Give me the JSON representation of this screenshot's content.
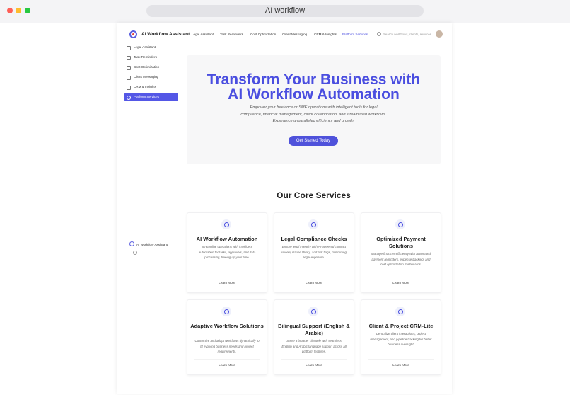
{
  "window": {
    "title": "AI workflow"
  },
  "nav": {
    "brand": "AI Workflow Assistant",
    "links": [
      "Legal Assistant",
      "Task Reminders",
      "Cost Optimization",
      "Client Messaging",
      "CRM & Insights",
      "Platform Services"
    ],
    "search_placeholder": "Search workflows, clients, services..."
  },
  "sidebar": {
    "items": [
      {
        "label": "Legal Assistant"
      },
      {
        "label": "Task Reminders"
      },
      {
        "label": "Cost Optimization"
      },
      {
        "label": "Client Messaging"
      },
      {
        "label": "CRM & Insights"
      },
      {
        "label": "Platform Services",
        "active": true
      }
    ],
    "footer_label": "AI Workflow Assistant"
  },
  "hero": {
    "title_line1": "Transform Your Business with",
    "title_line2": "AI Workflow Automation",
    "subtitle": "Empower your freelance or SME operations with intelligent tools for legal compliance, financial management, client collaboration, and streamlined workflows. Experience unparalleled efficiency and growth.",
    "cta": "Get Started Today"
  },
  "services": {
    "title": "Our Core Services",
    "cards": [
      {
        "title": "AI Workflow Automation",
        "desc": "Streamline operations with intelligent automation for tasks, approvals, and data processing, freeing up your time.",
        "link": "Learn More",
        "icon": "workflow-icon"
      },
      {
        "title": "Legal Compliance Checks",
        "desc": "Ensure legal integrity with AI-powered contract review, clause library, and risk flags, minimizing legal exposure.",
        "link": "Learn More",
        "icon": "scale-icon"
      },
      {
        "title": "Optimized Payment Solutions",
        "desc": "Manage finances efficiently with automated payment reminders, expense tracking, and cost optimization dashboards.",
        "link": "Learn More",
        "icon": "dollar-icon"
      },
      {
        "title": "Adaptive Workflow Solutions",
        "desc": "Customize and adapt workflows dynamically to fit evolving business needs and project requirements.",
        "link": "Learn More",
        "icon": "lightbulb-icon"
      },
      {
        "title": "Bilingual Support (English & Arabic)",
        "desc": "Serve a broader clientele with seamless English and Arabic language support across all platform features.",
        "link": "Learn More",
        "icon": "globe-icon"
      },
      {
        "title": "Client & Project CRM-Lite",
        "desc": "Centralize client interactions, project management, and pipeline tracking for better business oversight.",
        "link": "Learn More",
        "icon": "users-icon"
      }
    ]
  }
}
